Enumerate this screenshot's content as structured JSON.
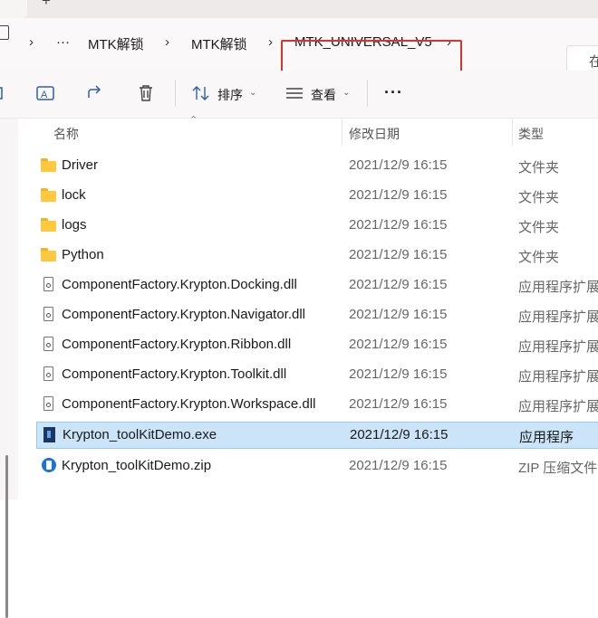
{
  "window": {
    "new_tab_glyph": "+"
  },
  "address_bar": {
    "crumbs": [
      {
        "label": "···"
      },
      {
        "label": "MTK解锁"
      },
      {
        "label": "MTK解锁"
      },
      {
        "label": "MTK_UNIVERSAL_V5"
      }
    ],
    "chevron": "›",
    "search_partial": "在",
    "highlight_color": "#d9342b"
  },
  "command_bar": {
    "sort_label": "排序",
    "view_label": "查看",
    "more_label": "···",
    "icons": [
      "rename-icon",
      "share-icon",
      "delete-icon",
      "sort-icon",
      "view-icon",
      "more-icon"
    ]
  },
  "columns": {
    "name": "名称",
    "date": "修改日期",
    "type": "类型"
  },
  "files": [
    {
      "name": "Driver",
      "date": "2021/12/9 16:15",
      "type": "文件夹",
      "icon": "folder-icon"
    },
    {
      "name": "lock",
      "date": "2021/12/9 16:15",
      "type": "文件夹",
      "icon": "folder-icon"
    },
    {
      "name": "logs",
      "date": "2021/12/9 16:15",
      "type": "文件夹",
      "icon": "folder-icon"
    },
    {
      "name": "Python",
      "date": "2021/12/9 16:15",
      "type": "文件夹",
      "icon": "folder-icon"
    },
    {
      "name": "ComponentFactory.Krypton.Docking.dll",
      "date": "2021/12/9 16:15",
      "type": "应用程序扩展",
      "icon": "dll-icon"
    },
    {
      "name": "ComponentFactory.Krypton.Navigator.dll",
      "date": "2021/12/9 16:15",
      "type": "应用程序扩展",
      "icon": "dll-icon"
    },
    {
      "name": "ComponentFactory.Krypton.Ribbon.dll",
      "date": "2021/12/9 16:15",
      "type": "应用程序扩展",
      "icon": "dll-icon"
    },
    {
      "name": "ComponentFactory.Krypton.Toolkit.dll",
      "date": "2021/12/9 16:15",
      "type": "应用程序扩展",
      "icon": "dll-icon"
    },
    {
      "name": "ComponentFactory.Krypton.Workspace.dll",
      "date": "2021/12/9 16:15",
      "type": "应用程序扩展",
      "icon": "dll-icon"
    },
    {
      "name": "Krypton_toolKitDemo.exe",
      "date": "2021/12/9 16:15",
      "type": "应用程序",
      "icon": "exe-icon",
      "selected": true
    },
    {
      "name": "Krypton_toolKitDemo.zip",
      "date": "2021/12/9 16:15",
      "type": "ZIP 压缩文件",
      "icon": "zip-icon"
    }
  ],
  "colors": {
    "selection": "#cce4f7",
    "accent": "#2b5fb0",
    "folder": "#ffc83d"
  }
}
